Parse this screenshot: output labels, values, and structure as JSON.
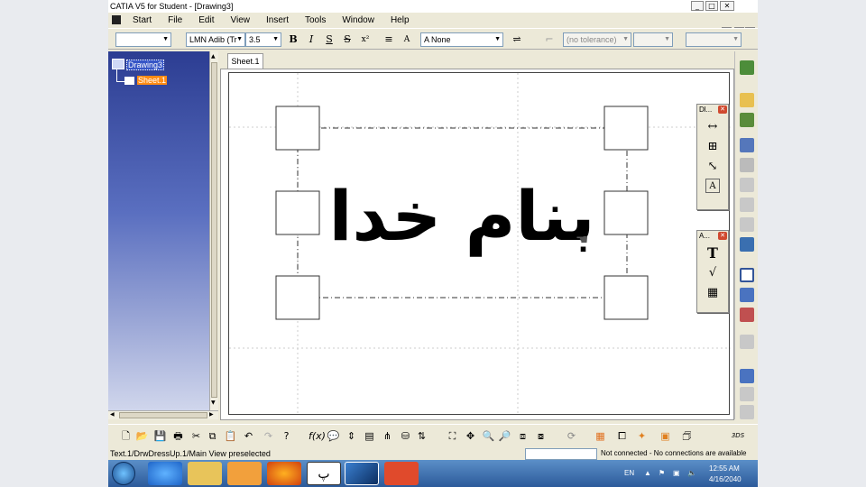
{
  "window": {
    "title": "CATIA V5 for Student - [Drawing3]"
  },
  "menu": [
    "Start",
    "File",
    "Edit",
    "View",
    "Insert",
    "Tools",
    "Window",
    "Help"
  ],
  "format_toolbar": {
    "font_name": "LMN Adib (Tr",
    "font_size": "3.5",
    "bold": "B",
    "italic": "I",
    "underline": "S",
    "strike": "S",
    "superscript": "x²",
    "frame_value": "None",
    "tolerance": "(no tolerance)"
  },
  "tree": {
    "root": "Drawing3",
    "child": "Sheet.1"
  },
  "sheet_tab": "Sheet.1",
  "drawing_text": "بنام خدا",
  "panels": {
    "dimension": {
      "title": "Dl..."
    },
    "annotation": {
      "title": "A...",
      "text_icon": "T"
    }
  },
  "status": {
    "message": "Text.1/DrwDressUp.1/Main View preselected",
    "connection": "Not connected - No connections are available"
  },
  "taskbar": {
    "language": "EN",
    "time": "12:55 AM",
    "date": "4/16/2040",
    "persian_app_label": "پ"
  },
  "colors": {
    "tree_gradient_top": "#2c3d92",
    "selected_node": "#ff8c14",
    "taskbar": "#3a6eb0"
  }
}
